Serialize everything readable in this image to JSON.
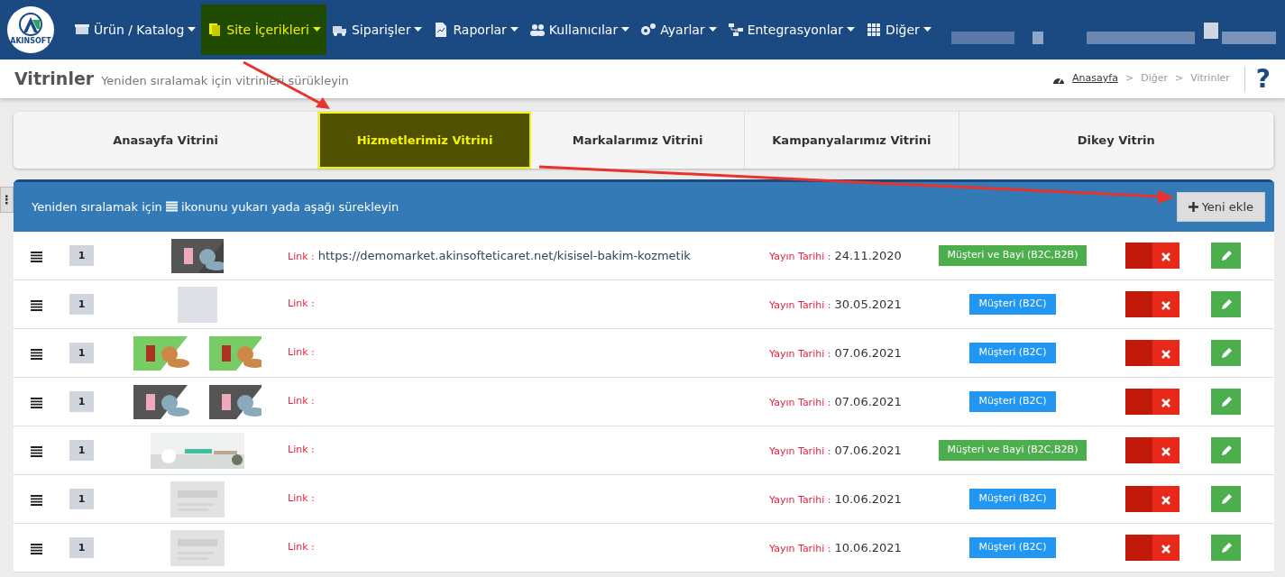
{
  "navbar": {
    "logo_text": "AKINSOFT",
    "menu": [
      {
        "label": "Ürün / Katalog",
        "selected": false
      },
      {
        "label": "Site İçerikleri",
        "selected": true
      },
      {
        "label": "Siparişler",
        "selected": false
      },
      {
        "label": "Raporlar",
        "selected": false
      },
      {
        "label": "Kullanıcılar",
        "selected": false
      },
      {
        "label": "Ayarlar",
        "selected": false
      },
      {
        "label": "Entegrasyonlar",
        "selected": false
      },
      {
        "label": "Diğer",
        "selected": false
      }
    ]
  },
  "page_header": {
    "title": "Vitrinler",
    "subtitle": "Yeniden sıralamak için vitrinleri sürükleyin",
    "breadcrumb": [
      {
        "label": "Anasayfa"
      },
      {
        "label": "Diğer"
      },
      {
        "label": "Vitrinler"
      }
    ],
    "breadcrumb_separator": ">",
    "help": "?"
  },
  "side_toggle": "⋮",
  "tabs": [
    {
      "label": "Anasayfa Vitrini",
      "selected": false
    },
    {
      "label": "Hizmetlerimiz Vitrini",
      "selected": true
    },
    {
      "label": "Markalarımız Vitrini",
      "selected": false
    },
    {
      "label": "Kampanyalarımız Vitrini",
      "selected": false
    },
    {
      "label": "Dikey Vitrin",
      "selected": false
    }
  ],
  "panel": {
    "hint_before": "Yeniden sıralamak için",
    "hint_after": "ikonunu yukarı yada aşağı sürekleyin",
    "add_button": "Yeni ekle"
  },
  "rows": [
    {
      "order": "1",
      "link_label": "Link :",
      "link": "https://demomarket.akinsofteticaret.net/kisisel-bakim-kozmetik",
      "date_label": "Yayın Tarihi :",
      "date": "24.11.2020",
      "audience": "Müşteri ve Bayi (B2C,B2B)",
      "color": "#4cae4c"
    },
    {
      "order": "1",
      "images": [
        {
          "kind": "blank"
        }
      ],
      "link_label": "Link :",
      "date_label": "Yayın Tarihi :",
      "date": "30.05.2021",
      "audience": "Müşteri (B2C)",
      "color": "#2196f3"
    },
    {
      "order": "1",
      "link_label": "Link :",
      "date_label": "Yayın Tarihi :",
      "date": "07.06.2021",
      "audience": "Müşteri (B2C)",
      "color": "#2196f3"
    },
    {
      "order": "1",
      "link_label": "Link :",
      "date_label": "Yayın Tarihi :",
      "date": "07.06.2021",
      "audience": "Müşteri (B2C)",
      "color": "#2196f3"
    },
    {
      "order": "1",
      "images": [
        {
          "kind": "wide"
        }
      ],
      "link_label": "Link :",
      "date_label": "Yayın Tarihi :",
      "date": "07.06.2021",
      "audience": "Müşteri ve Bayi (B2C,B2B)",
      "color": "#4cae4c"
    },
    {
      "order": "1",
      "images": [
        {
          "kind": "placeholder"
        }
      ],
      "link_label": "Link :",
      "date_label": "Yayın Tarihi :",
      "date": "10.06.2021",
      "audience": "Müşteri (B2C)",
      "color": "#2196f3"
    },
    {
      "order": "1",
      "images": [
        {
          "kind": "placeholder"
        }
      ],
      "link_label": "Link :",
      "date_label": "Yayın Tarihi :",
      "date": "10.06.2021",
      "audience": "Müşteri (B2C)",
      "color": "#2196f3"
    }
  ]
}
